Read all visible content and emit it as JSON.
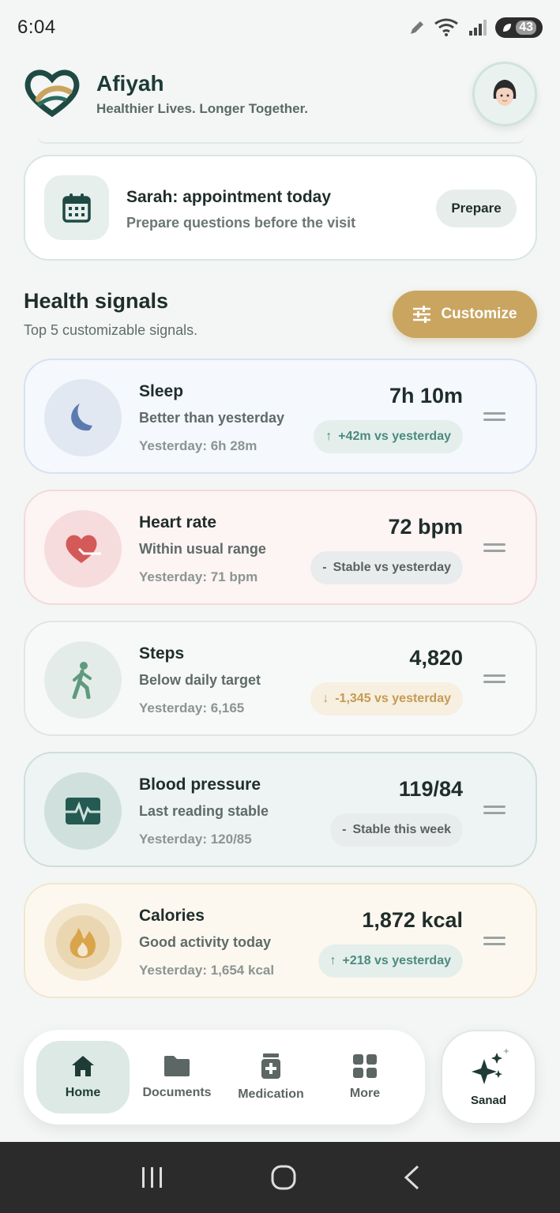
{
  "status_bar": {
    "time": "6:04",
    "battery": "43"
  },
  "header": {
    "app_name": "Afiyah",
    "tagline": "Healthier Lives. Longer Together."
  },
  "appointment": {
    "title": "Sarah: appointment today",
    "subtitle": "Prepare questions before the visit",
    "button": "Prepare"
  },
  "health": {
    "title": "Health signals",
    "subtitle": "Top 5 customizable signals.",
    "customize": "Customize",
    "signals": [
      {
        "name": "Sleep",
        "status": "Better than yesterday",
        "yesterday": "Yesterday: 6h 28m",
        "value": "7h 10m",
        "delta_arrow": "↑",
        "delta": "+42m vs yesterday",
        "icon": "moon-icon"
      },
      {
        "name": "Heart rate",
        "status": "Within usual range",
        "yesterday": "Yesterday: 71 bpm",
        "value": "72 bpm",
        "delta_arrow": "-",
        "delta": "Stable vs yesterday",
        "icon": "heart-icon"
      },
      {
        "name": "Steps",
        "status": "Below daily target",
        "yesterday": "Yesterday: 6,165",
        "value": "4,820",
        "delta_arrow": "↓",
        "delta": "-1,345 vs yesterday",
        "icon": "walking-icon"
      },
      {
        "name": "Blood pressure",
        "status": "Last reading stable",
        "yesterday": "Yesterday: 120/85",
        "value": "119/84",
        "delta_arrow": "-",
        "delta": "Stable this week",
        "icon": "monitor-pulse-icon"
      },
      {
        "name": "Calories",
        "status": "Good activity today",
        "yesterday": "Yesterday: 1,654 kcal",
        "value": "1,872 kcal",
        "delta_arrow": "↑",
        "delta": "+218 vs yesterday",
        "icon": "flame-icon"
      }
    ]
  },
  "nav": {
    "home": "Home",
    "documents": "Documents",
    "medication": "Medication",
    "more": "More",
    "sanad": "Sanad"
  },
  "colors": {
    "accent": "#c9a560",
    "primary": "#1d3b37",
    "green": "#4b8a7c",
    "amber": "#c49b52"
  }
}
